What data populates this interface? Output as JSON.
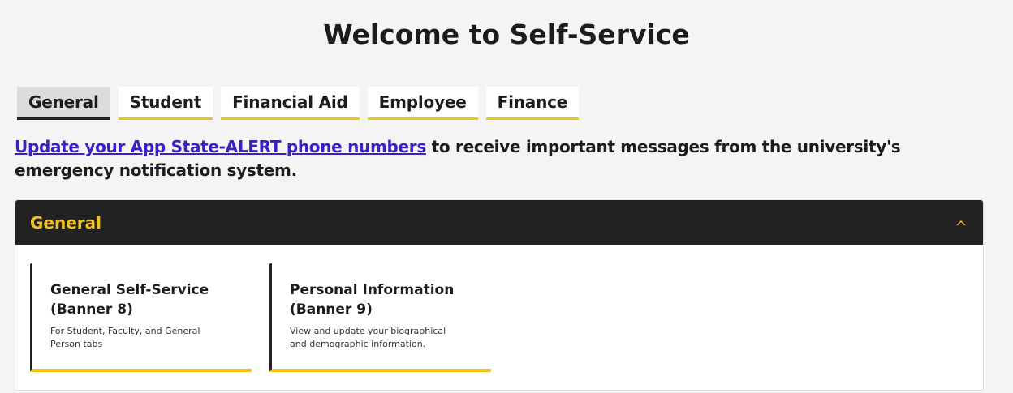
{
  "page": {
    "title": "Welcome to Self-Service"
  },
  "tabs": [
    {
      "label": "General",
      "active": true
    },
    {
      "label": "Student",
      "active": false
    },
    {
      "label": "Financial Aid",
      "active": false
    },
    {
      "label": "Employee",
      "active": false
    },
    {
      "label": "Finance",
      "active": false
    }
  ],
  "alert": {
    "link_text": "Update your App State-ALERT phone numbers",
    "rest_text": " to receive important messages from the university's emergency notification system."
  },
  "panel": {
    "title": "General",
    "toggle_icon": "chevron-up-icon",
    "cards": [
      {
        "title_line1": "General Self-Service",
        "title_line2": "(Banner 8)",
        "description": "For Student, Faculty, and General Person tabs"
      },
      {
        "title_line1": "Personal Information",
        "title_line2": "(Banner 9)",
        "description": "View and update your biographical and demographic information."
      }
    ]
  },
  "colors": {
    "accent": "#f2c21b",
    "header_bg": "#222222",
    "link": "#3b20c8",
    "page_bg": "#f4f4f4"
  }
}
